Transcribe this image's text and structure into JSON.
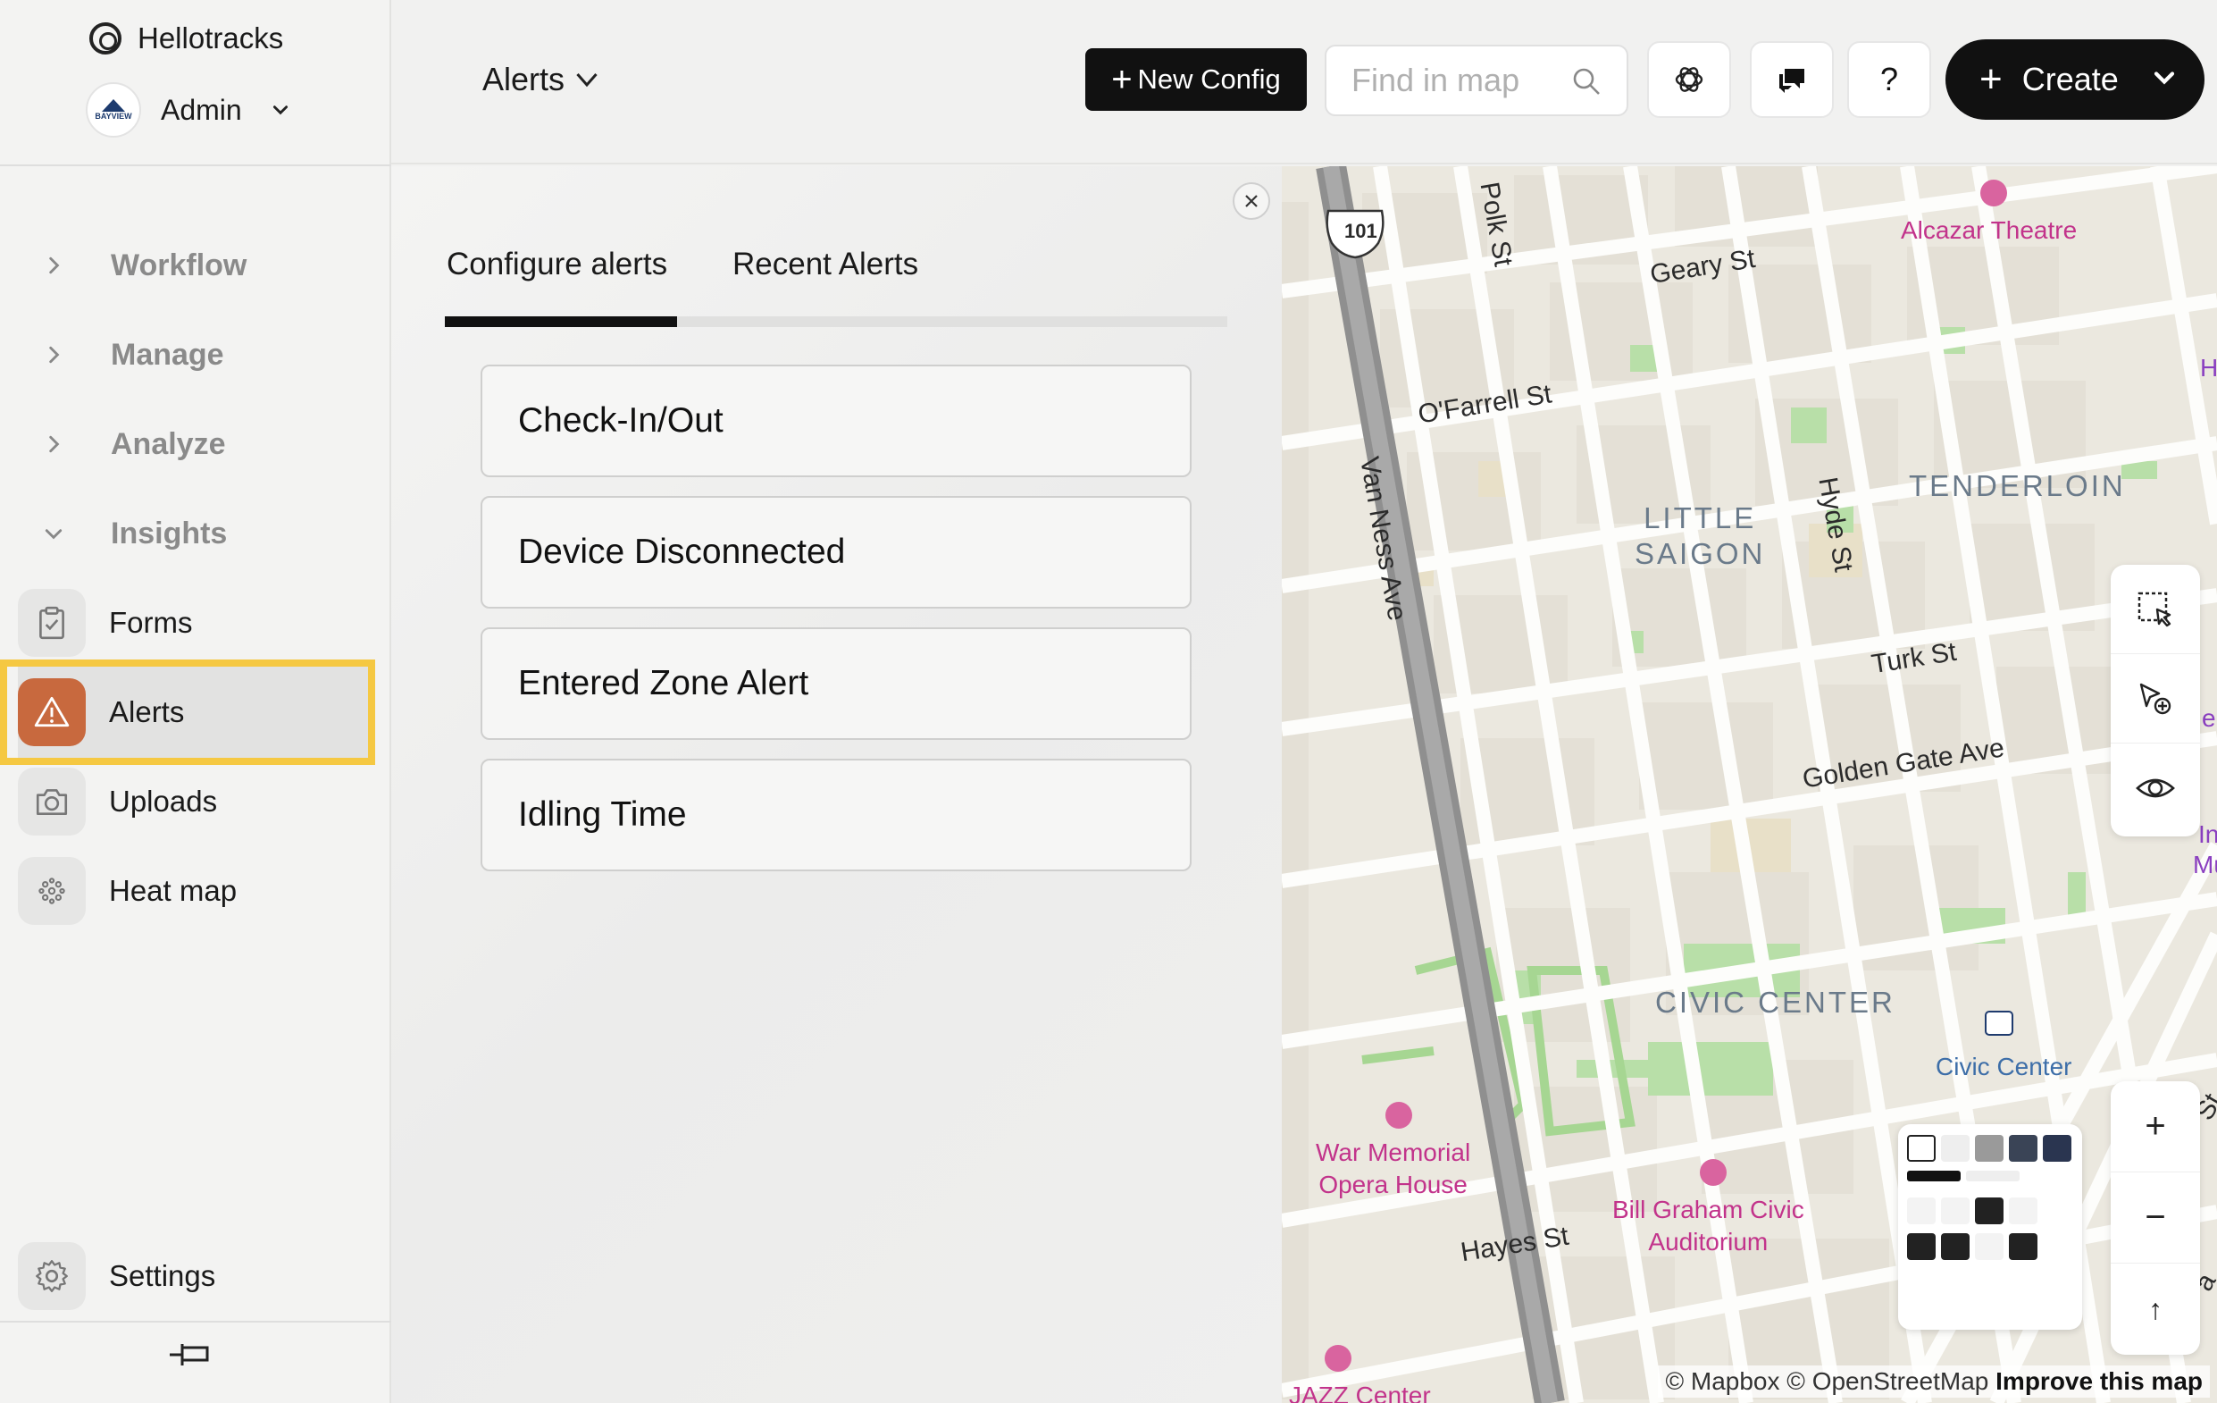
{
  "sidebar": {
    "brand": "Hellotracks",
    "account": {
      "name": "Admin",
      "avatar_text": "BAYVIEW"
    },
    "groups": [
      {
        "label": "Workflow",
        "expanded": false
      },
      {
        "label": "Manage",
        "expanded": false
      },
      {
        "label": "Analyze",
        "expanded": false
      },
      {
        "label": "Insights",
        "expanded": true
      }
    ],
    "items": [
      {
        "label": "Forms",
        "icon": "clipboard-icon"
      },
      {
        "label": "Alerts",
        "icon": "warning-icon",
        "active": true
      },
      {
        "label": "Uploads",
        "icon": "camera-icon"
      },
      {
        "label": "Heat map",
        "icon": "dots-grid-icon"
      }
    ],
    "settings": "Settings"
  },
  "header": {
    "title": "Alerts",
    "new_config": "New Config",
    "search_placeholder": "Find in map",
    "help": "?",
    "create": "Create"
  },
  "panel": {
    "tabs": [
      {
        "label": "Configure alerts",
        "active": true
      },
      {
        "label": "Recent Alerts",
        "active": false
      }
    ],
    "alerts": [
      "Check-In/Out",
      "Device Disconnected",
      "Entered Zone Alert",
      "Idling Time"
    ]
  },
  "map": {
    "highway_shield": "101",
    "streets": [
      "Polk St",
      "Geary St",
      "O'Farrell St",
      "Van Ness Ave",
      "Hyde St",
      "Turk St",
      "Golden Gate Ave",
      "Hayes St"
    ],
    "districts": [
      "LITTLE\nSAIGON",
      "TENDERLOIN",
      "CIVIC CENTER"
    ],
    "pois": [
      "Alcazar Theatre",
      "War Memorial\nOpera House",
      "Bill Graham Civic\nAuditorium",
      "JAZZ Center"
    ],
    "transit": "Civic Center",
    "edge_labels": [
      "H",
      "er",
      "In",
      "Mus",
      "St",
      "a"
    ],
    "attribution": {
      "mapbox": "© Mapbox",
      "osm": "© OpenStreetMap",
      "improve": "Improve this map"
    },
    "zoom_in": "+",
    "zoom_out": "−",
    "north": "↑"
  },
  "colors": {
    "accent": "#111111",
    "active_icon_bg": "#c8693e",
    "highlight_border": "#f5c842",
    "poi": "#c2338b",
    "district": "#6a7a8a"
  }
}
